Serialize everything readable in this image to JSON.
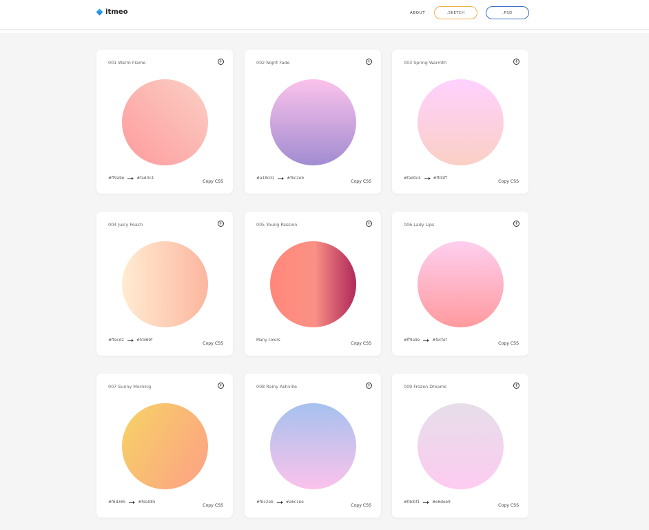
{
  "header": {
    "logo_text": "itmeo",
    "about_label": "ABOUT",
    "sketch_label": ".SKETCH",
    "psd_label": ".PSD",
    "accent_sketch": "#f0b04a",
    "accent_psd": "#3a6fc4"
  },
  "cards": [
    {
      "title": "001 Warm Flame",
      "from": "#ff9a9e",
      "to": "#fad0c4",
      "copy_label": "Copy CSS",
      "gradient": [
        "#ff9a9e",
        "#fad0c4"
      ],
      "direction": "45deg"
    },
    {
      "title": "002 Night Fade",
      "from": "#a18cd1",
      "to": "#fbc2eb",
      "copy_label": "Copy CSS",
      "gradient": [
        "#a18cd1",
        "#fbc2eb"
      ],
      "direction": "to top"
    },
    {
      "title": "003 Spring Warmth",
      "from": "#fad0c4",
      "to": "#ffd1ff",
      "copy_label": "Copy CSS",
      "gradient": [
        "#fad0c4",
        "#ffd1ff"
      ],
      "direction": "to top"
    },
    {
      "title": "004 Juicy Peach",
      "from": "#ffecd2",
      "to": "#fcb69f",
      "copy_label": "Copy CSS",
      "gradient": [
        "#ffecd2",
        "#fcb69f"
      ],
      "direction": "to right"
    },
    {
      "title": "005 Young Passion",
      "note": "Many colors",
      "copy_label": "Copy CSS",
      "multi": true
    },
    {
      "title": "006 Lady Lips",
      "from": "#ff9a9e",
      "to": "#fecfef",
      "copy_label": "Copy CSS",
      "gradient": [
        "#ff9a9e",
        "#fecfef"
      ],
      "direction": "to top"
    },
    {
      "title": "007 Sunny Morning",
      "from": "#f6d365",
      "to": "#fda085",
      "copy_label": "Copy CSS",
      "gradient": [
        "#f6d365",
        "#fda085"
      ],
      "direction": "120deg"
    },
    {
      "title": "008 Rainy Ashville",
      "from": "#fbc2eb",
      "to": "#a6c1ee",
      "copy_label": "Copy CSS",
      "gradient": [
        "#fbc2eb",
        "#a6c1ee"
      ],
      "direction": "to top"
    },
    {
      "title": "009 Frozen Dreams",
      "from": "#fdcbf1",
      "to": "#e6dee9",
      "copy_label": "Copy CSS",
      "gradient": [
        "#fdcbf1",
        "#e6dee9"
      ],
      "direction": "to top"
    }
  ]
}
